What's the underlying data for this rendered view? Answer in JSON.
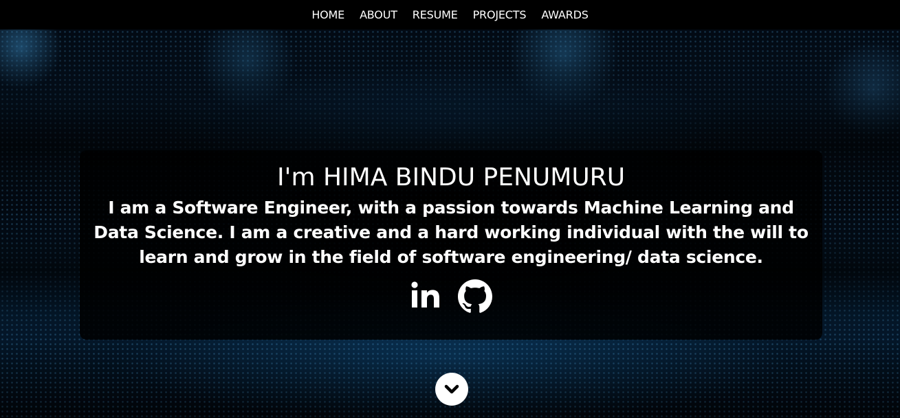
{
  "nav": {
    "items": [
      "HOME",
      "ABOUT",
      "RESUME",
      "PROJECTS",
      "AWARDS"
    ]
  },
  "intro": {
    "title": "I'm HIMA BINDU PENUMURU",
    "description": "I am a Software Engineer, with a passion towards Machine Learning and Data Science. I am a creative and a hard working individual with the will to learn and grow in the field of software engineering/ data science."
  },
  "social": {
    "icons": [
      "linkedin-icon",
      "github-icon"
    ]
  },
  "scroll": {
    "icon": "chevron-down-icon"
  },
  "colors": {
    "navbar": "#000000",
    "text": "#ffffff",
    "accent": "#1e8fe0"
  }
}
